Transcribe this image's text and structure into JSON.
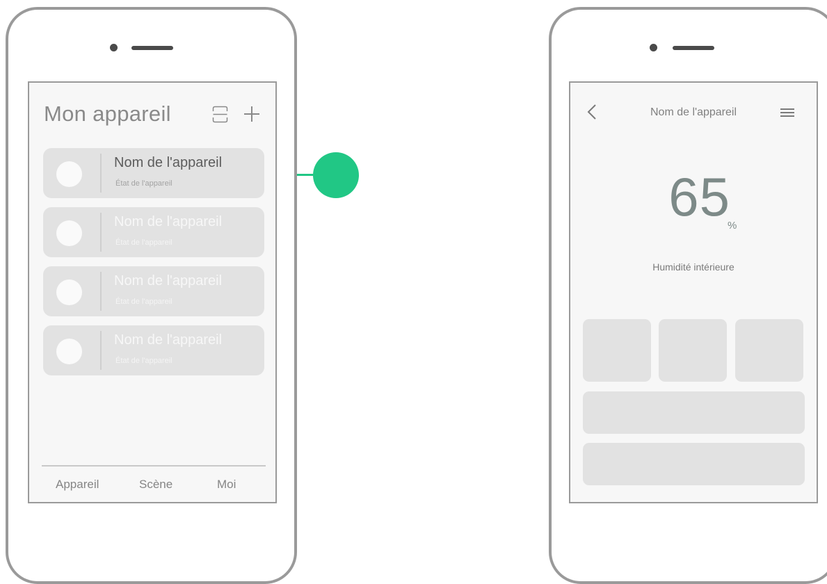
{
  "device_list_screen": {
    "title": "Mon appareil",
    "icons": [
      "scan-icon",
      "plus-icon"
    ],
    "devices": [
      {
        "name": "Nom de l'appareil",
        "status": "État de l'appareil",
        "active": true
      },
      {
        "name": "Nom de l'appareil",
        "status": "État de l'appareil",
        "active": false
      },
      {
        "name": "Nom de l'appareil",
        "status": "État de l'appareil",
        "active": false
      },
      {
        "name": "Nom de l'appareil",
        "status": "État de l'appareil",
        "active": false
      }
    ],
    "tabs": [
      "Appareil",
      "Scène",
      "Moi"
    ]
  },
  "device_detail_screen": {
    "header_title": "Nom de l'appareil",
    "icons": [
      "back-chevron-icon",
      "menu-icon"
    ],
    "reading_value": "65",
    "reading_unit": "%",
    "reading_label": "Humidité intérieure"
  },
  "colors": {
    "accent": "#21c785",
    "phone_frame": "#9a9a9a",
    "card": "#e2e2e2",
    "screen_bg": "#f7f7f7"
  }
}
